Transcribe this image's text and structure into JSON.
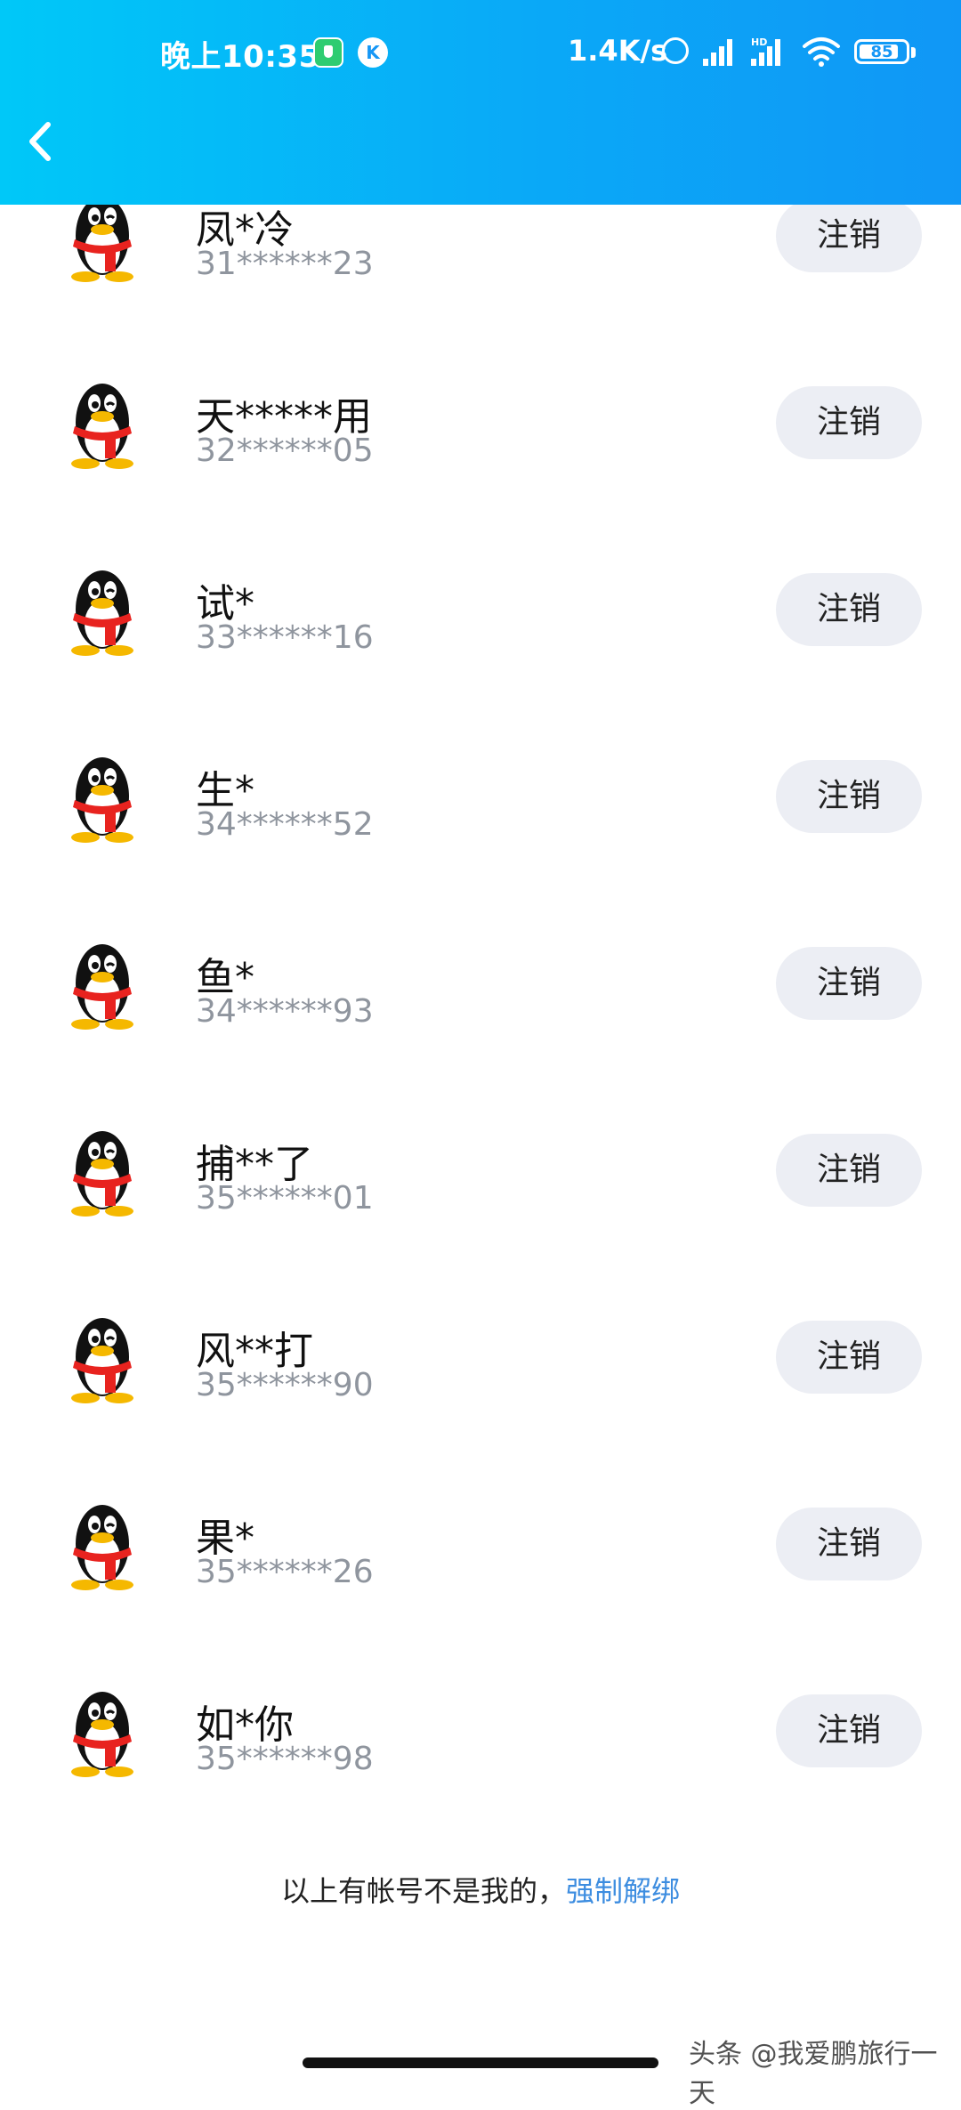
{
  "status_bar": {
    "time": "晚上10:35",
    "app_badge_letter": "K",
    "net_speed": "1.4K/s",
    "signal_label": "HD",
    "battery": "85",
    "battery_level": 0.85
  },
  "header": {
    "back_icon": "chevron-left-icon"
  },
  "accounts": [
    {
      "name": "凤*冷",
      "number": "31******23",
      "action": "注销"
    },
    {
      "name": "天*****用",
      "number": "32******05",
      "action": "注销"
    },
    {
      "name": "试*",
      "number": "33******16",
      "action": "注销"
    },
    {
      "name": "生*",
      "number": "34******52",
      "action": "注销"
    },
    {
      "name": "鱼*",
      "number": "34******93",
      "action": "注销"
    },
    {
      "name": "捕**了",
      "number": "35******01",
      "action": "注销"
    },
    {
      "name": "风**打",
      "number": "35******90",
      "action": "注销"
    },
    {
      "name": "果*",
      "number": "35******26",
      "action": "注销"
    },
    {
      "name": "如*你",
      "number": "35******98",
      "action": "注销"
    }
  ],
  "footer": {
    "note": "以上有帐号不是我的，",
    "link": "强制解绑"
  },
  "watermark": "头条 @我爱鹏旅行一天",
  "colors": {
    "header_start": "#00c8f8",
    "header_end": "#1097f6",
    "link": "#3d8de0",
    "button_bg": "#eceef4"
  }
}
